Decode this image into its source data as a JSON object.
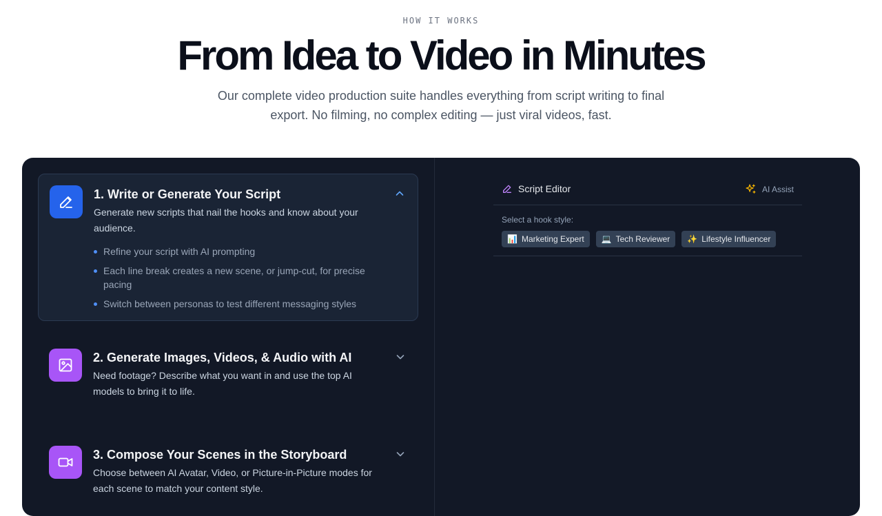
{
  "hero": {
    "eyebrow": "HOW IT WORKS",
    "headline": "From Idea to Video in Minutes",
    "subtitle": "Our complete video production suite handles everything from script writing to final export. No filming, no complex editing — just viral videos, fast."
  },
  "steps": [
    {
      "title": "1. Write or Generate Your Script",
      "description": "Generate new scripts that nail the hooks and know about your audience.",
      "bullets": [
        "Refine your script with AI prompting",
        "Each line break creates a new scene, or jump-cut, for precise pacing",
        "Switch between personas to test different messaging styles"
      ],
      "icon": "pencil-icon",
      "expanded": true
    },
    {
      "title": "2. Generate Images, Videos, & Audio with AI",
      "description": "Need footage? Describe what you want in and use the top AI models to bring it to life.",
      "icon": "image-icon",
      "expanded": false
    },
    {
      "title": "3. Compose Your Scenes in the Storyboard",
      "description": "Choose between AI Avatar, Video, or Picture-in-Picture modes for each scene to match your content style.",
      "icon": "video-camera-icon",
      "expanded": false
    }
  ],
  "editor": {
    "title": "Script Editor",
    "ai_assist": "AI Assist",
    "hook_label": "Select a hook style:",
    "hooks": [
      {
        "emoji": "📊",
        "label": "Marketing Expert"
      },
      {
        "emoji": "💻",
        "label": "Tech Reviewer"
      },
      {
        "emoji": "✨",
        "label": "Lifestyle Influencer"
      }
    ]
  },
  "colors": {
    "panel_bg": "#121826",
    "accent_blue": "#2563eb",
    "accent_purple": "#a855f7",
    "bullet_dot": "#4f8ff7"
  }
}
